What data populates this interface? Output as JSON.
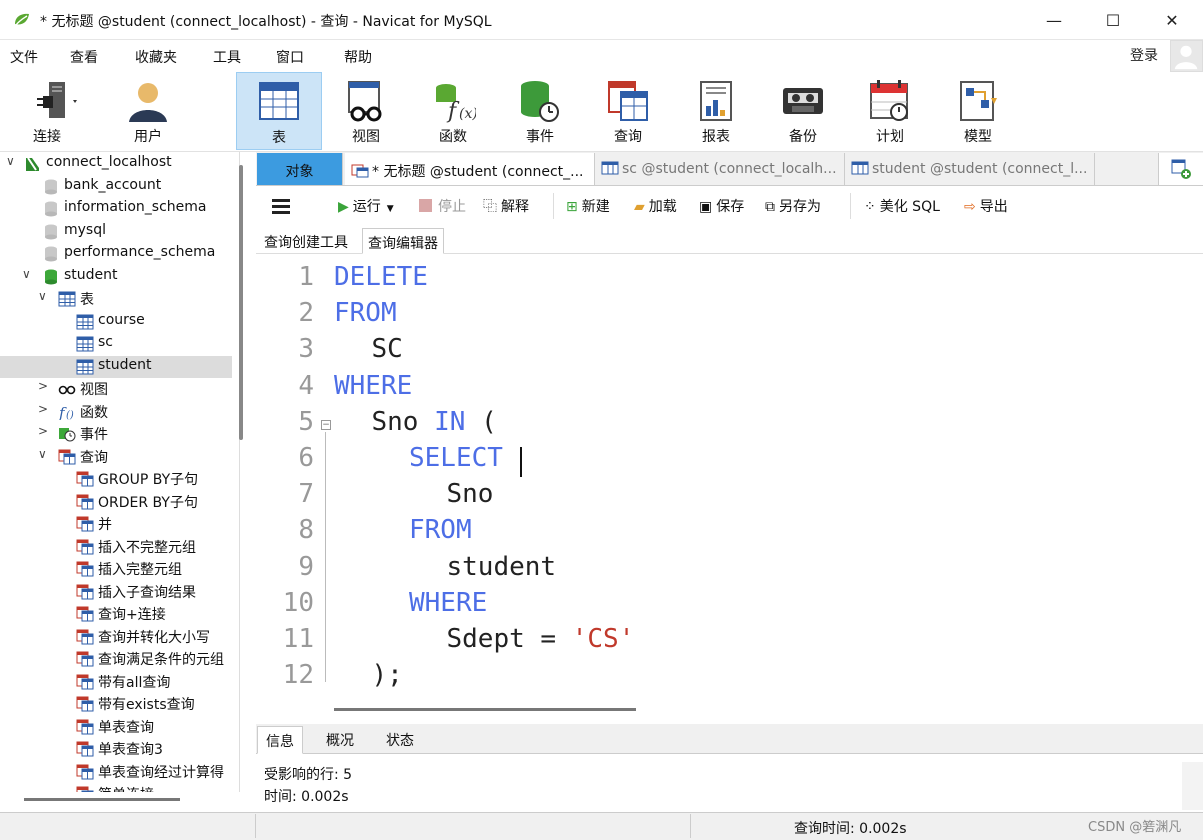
{
  "window": {
    "title": "* 无标题 @student (connect_localhost) - 查询 - Navicat for MySQL",
    "minimize": "—",
    "maximize": "☐",
    "close": "✕"
  },
  "menu": [
    "文件",
    "查看",
    "收藏夹",
    "工具",
    "窗口",
    "帮助"
  ],
  "login_label": "登录",
  "toolbar": [
    {
      "label": "连接",
      "icon": "plug-icon"
    },
    {
      "label": "用户",
      "icon": "user-icon"
    },
    {
      "label": "表",
      "icon": "table-icon",
      "active": true
    },
    {
      "label": "视图",
      "icon": "view-icon"
    },
    {
      "label": "函数",
      "icon": "function-icon"
    },
    {
      "label": "事件",
      "icon": "event-icon"
    },
    {
      "label": "查询",
      "icon": "query-icon"
    },
    {
      "label": "报表",
      "icon": "report-icon"
    },
    {
      "label": "备份",
      "icon": "backup-icon"
    },
    {
      "label": "计划",
      "icon": "schedule-icon"
    },
    {
      "label": "模型",
      "icon": "model-icon"
    }
  ],
  "tree": [
    {
      "text": "connect_localhost",
      "arrow": "∨",
      "icon": "connection-icon",
      "level": 0
    },
    {
      "text": "bank_account",
      "icon": "database-icon",
      "level": 1
    },
    {
      "text": "information_schema",
      "icon": "database-icon",
      "level": 1
    },
    {
      "text": "mysql",
      "icon": "database-icon",
      "level": 1
    },
    {
      "text": "performance_schema",
      "icon": "database-icon",
      "level": 1
    },
    {
      "text": "student",
      "arrow": "∨",
      "icon": "database-open-icon",
      "level": 1
    },
    {
      "text": "表",
      "arrow": "∨",
      "icon": "table-icon",
      "level": 2
    },
    {
      "text": "course",
      "icon": "table-icon",
      "level": 3
    },
    {
      "text": "sc",
      "icon": "table-icon",
      "level": 3
    },
    {
      "text": "student",
      "icon": "table-icon",
      "level": 3,
      "selected": true
    },
    {
      "text": "视图",
      "arrow": ">",
      "icon": "view-icon",
      "level": 2
    },
    {
      "text": "函数",
      "arrow": ">",
      "icon": "function-icon",
      "level": 2
    },
    {
      "text": "事件",
      "arrow": ">",
      "icon": "event-icon",
      "level": 2
    },
    {
      "text": "查询",
      "arrow": "∨",
      "icon": "query-icon",
      "level": 2
    },
    {
      "text": "GROUP BY子句",
      "icon": "query-icon",
      "level": 3
    },
    {
      "text": "ORDER BY子句",
      "icon": "query-icon",
      "level": 3
    },
    {
      "text": "并",
      "icon": "query-icon",
      "level": 3
    },
    {
      "text": "插入不完整元组",
      "icon": "query-icon",
      "level": 3
    },
    {
      "text": "插入完整元组",
      "icon": "query-icon",
      "level": 3
    },
    {
      "text": "插入子查询结果",
      "icon": "query-icon",
      "level": 3
    },
    {
      "text": "查询+连接",
      "icon": "query-icon",
      "level": 3
    },
    {
      "text": "查询并转化大小写",
      "icon": "query-icon",
      "level": 3
    },
    {
      "text": "查询满足条件的元组",
      "icon": "query-icon",
      "level": 3
    },
    {
      "text": "带有all查询",
      "icon": "query-icon",
      "level": 3
    },
    {
      "text": "带有exists查询",
      "icon": "query-icon",
      "level": 3
    },
    {
      "text": "单表查询",
      "icon": "query-icon",
      "level": 3
    },
    {
      "text": "单表查询3",
      "icon": "query-icon",
      "level": 3
    },
    {
      "text": "单表查询经过计算得",
      "icon": "query-icon",
      "level": 3
    },
    {
      "text": "简单连接",
      "icon": "query-icon",
      "level": 3
    }
  ],
  "tabs": {
    "objects": "对象",
    "items": [
      {
        "label": "* 无标题 @student (connect_...",
        "active": true
      },
      {
        "label": "sc @student (connect_localh..."
      },
      {
        "label": "student @student (connect_l..."
      }
    ]
  },
  "query_toolbar": {
    "run": "运行",
    "stop": "停止",
    "explain": "解释",
    "new": "新建",
    "load": "加载",
    "save": "保存",
    "save_as": "另存为",
    "beautify": "美化 SQL",
    "export": "导出"
  },
  "subtabs": [
    "查询创建工具",
    "查询编辑器"
  ],
  "editor": {
    "line_numbers": [
      "1",
      "2",
      "3",
      "4",
      "5",
      "6",
      "7",
      "8",
      "9",
      "10",
      "11",
      "12"
    ],
    "lines": [
      {
        "indent": 0,
        "parts": [
          {
            "t": "DELETE",
            "k": "kw"
          }
        ]
      },
      {
        "indent": 0,
        "parts": [
          {
            "t": "FROM",
            "k": "kw"
          }
        ]
      },
      {
        "indent": 1,
        "parts": [
          {
            "t": "SC",
            "k": "id"
          }
        ]
      },
      {
        "indent": 0,
        "parts": [
          {
            "t": "WHERE",
            "k": "kw"
          }
        ]
      },
      {
        "indent": 1,
        "parts": [
          {
            "t": "Sno ",
            "k": "id"
          },
          {
            "t": "IN",
            "k": "kw"
          },
          {
            "t": " (",
            "k": "id"
          }
        ]
      },
      {
        "indent": 2,
        "parts": [
          {
            "t": "SELECT",
            "k": "kw"
          }
        ]
      },
      {
        "indent": 3,
        "parts": [
          {
            "t": "Sno",
            "k": "id"
          }
        ]
      },
      {
        "indent": 2,
        "parts": [
          {
            "t": "FROM",
            "k": "kw"
          }
        ]
      },
      {
        "indent": 3,
        "parts": [
          {
            "t": "student",
            "k": "id"
          }
        ]
      },
      {
        "indent": 2,
        "parts": [
          {
            "t": "WHERE",
            "k": "kw"
          }
        ]
      },
      {
        "indent": 3,
        "parts": [
          {
            "t": "Sdept = ",
            "k": "id"
          },
          {
            "t": "'CS'",
            "k": "str"
          }
        ]
      },
      {
        "indent": 1,
        "parts": [
          {
            "t": ");",
            "k": "id"
          }
        ]
      }
    ]
  },
  "info_tabs": [
    "信息",
    "概况",
    "状态"
  ],
  "info": {
    "affected_rows": "受影响的行: 5",
    "time": "时间: 0.002s"
  },
  "status": {
    "query_time": "查询时间: 0.002s"
  },
  "watermark": "CSDN @箬渊凡",
  "colors": {
    "keyword": "#4d6ee6",
    "string": "#c0392b",
    "active_tab": "#3c9be0",
    "toolbar_active": "#cce4f7"
  }
}
